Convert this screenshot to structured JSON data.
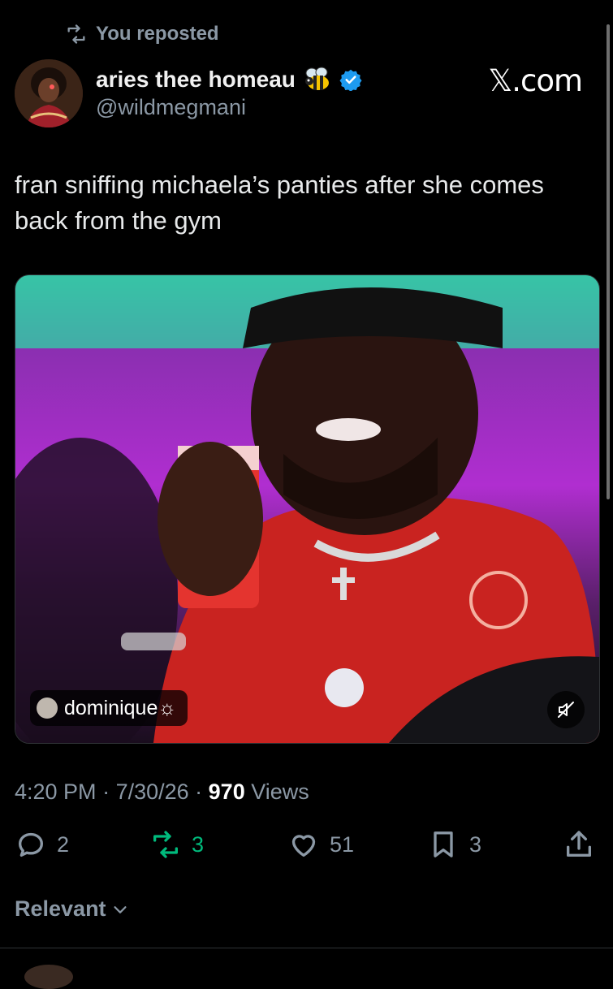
{
  "repost": {
    "label": "You reposted"
  },
  "author": {
    "display_name": "aries thee homeau",
    "handle": "@wildmegmani",
    "badge_icon": "bee-emoji-icon",
    "verified_icon": "verified-badge-icon",
    "verified_color": "#1d9bf0"
  },
  "logo": {
    "text": "𝕏.com"
  },
  "tweet": {
    "text": "fran sniffing michaela’s panties after she comes back from the gym"
  },
  "media": {
    "tag_label": "dominique☼",
    "mute_icon": "muted-speaker-icon"
  },
  "meta": {
    "time": "4:20 PM",
    "sep1": " · ",
    "date": "7/30/26",
    "sep2": " · ",
    "views_count": "970",
    "views_label": " Views"
  },
  "actions": {
    "replies": "2",
    "reposts": "3",
    "likes": "51",
    "bookmarks": "3"
  },
  "colors": {
    "repost_active": "#00ba7c",
    "muted_text": "#8b98a5",
    "background": "#000000"
  },
  "sort": {
    "label": "Relevant"
  }
}
